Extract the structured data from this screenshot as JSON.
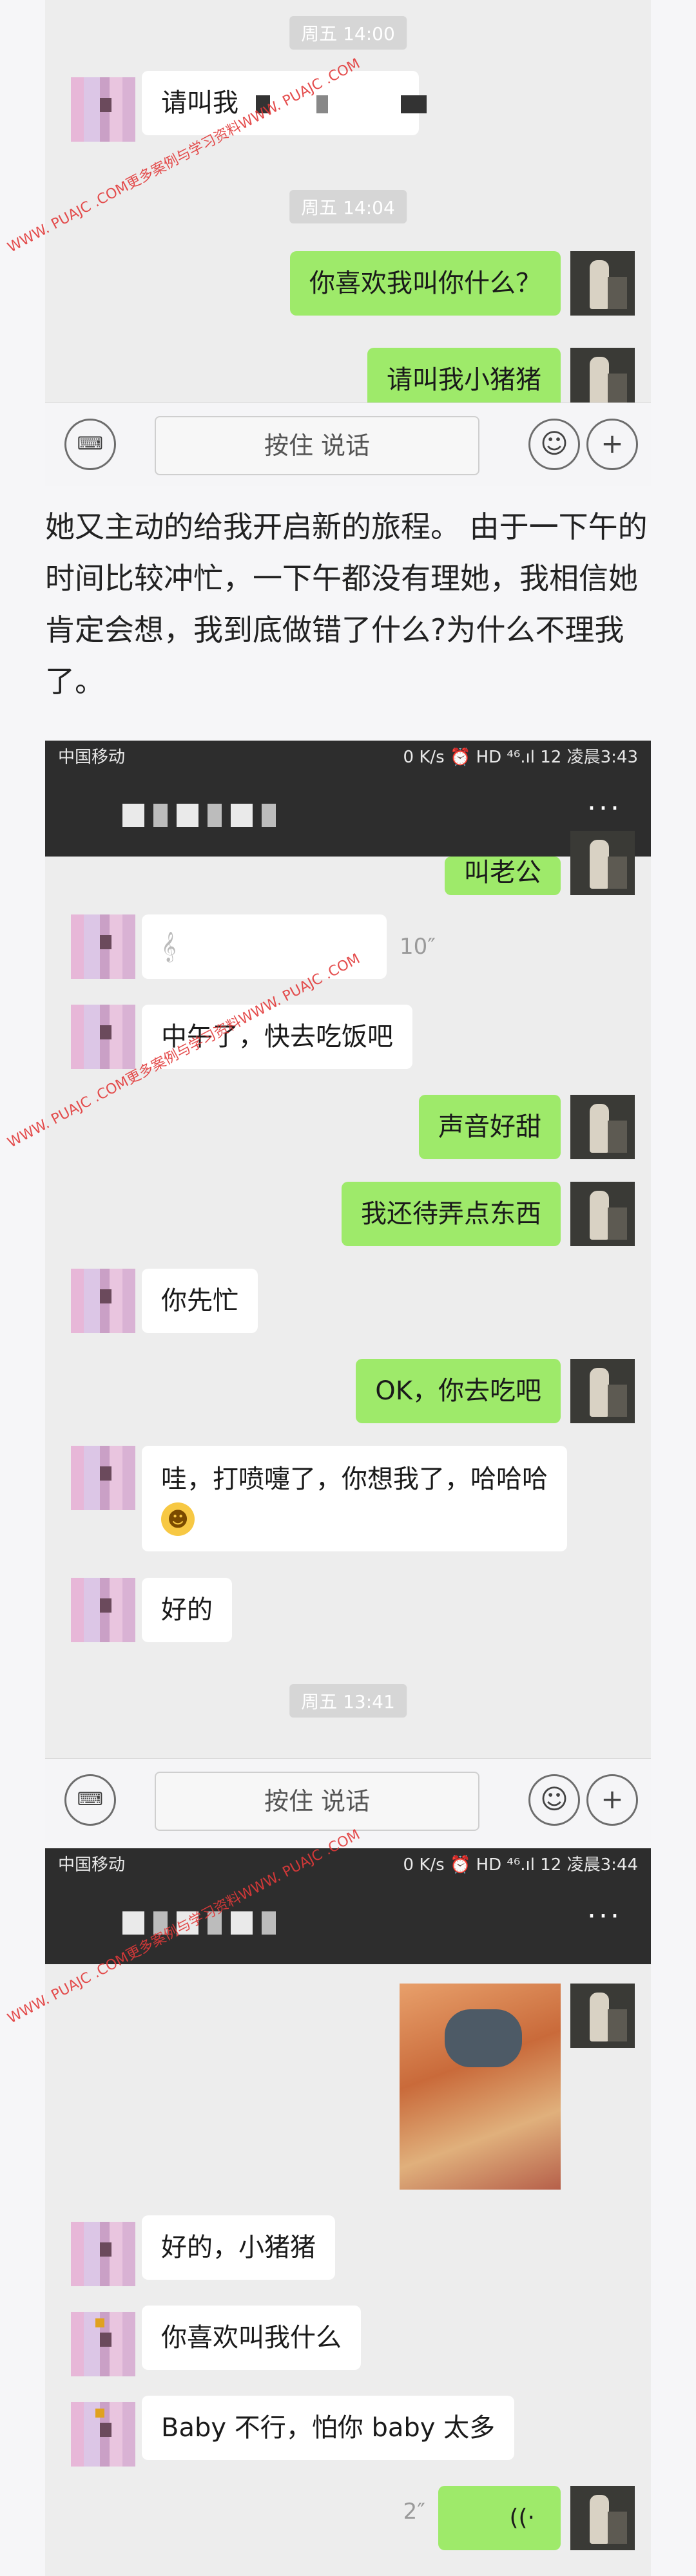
{
  "panel1": {
    "timestamps": [
      "周五 14:00",
      "周五 14:04"
    ],
    "messages": [
      {
        "from": "her",
        "text": "请叫我"
      },
      {
        "from": "me",
        "text": "你喜欢我叫你什么？"
      },
      {
        "from": "me",
        "text": "请叫我小猪猪"
      }
    ],
    "input": {
      "hold_to_talk": "按住 说话"
    }
  },
  "article": {
    "paragraph": "她又主动的给我开启新的旅程。 由于一下午的时间比较冲忙，一下午都没有理她，我相信她肯定会想，我到底做错了什么?为什么不理我了。"
  },
  "panel2": {
    "status": {
      "carrier": "中国移动",
      "right": "0 K/s ⏰ HD ⁴⁶.ıl 12 凌晨3:43"
    },
    "partial_top": "叫老公",
    "voice_duration": "10″",
    "messages": [
      {
        "from": "her",
        "text": "中午了，快去吃饭吧"
      },
      {
        "from": "me",
        "text": "声音好甜"
      },
      {
        "from": "me",
        "text": "我还待弄点东西"
      },
      {
        "from": "her",
        "text": "你先忙"
      },
      {
        "from": "me",
        "text": "OK，你去吃吧"
      },
      {
        "from": "her",
        "text": "哇，打喷嚏了，你想我了，哈哈哈"
      },
      {
        "from": "her",
        "text": "好的"
      }
    ],
    "timestamp": "周五 13:41",
    "input": {
      "hold_to_talk": "按住 说话"
    }
  },
  "panel3": {
    "status": {
      "carrier": "中国移动",
      "right": "0 K/s ⏰ HD ⁴⁶.ıl 12 凌晨3:44"
    },
    "messages": [
      {
        "from": "her",
        "text": "好的，小猪猪"
      },
      {
        "from": "her",
        "text": "你喜欢叫我什么"
      },
      {
        "from": "her",
        "text": "Baby 不行，怕你 baby 太多"
      }
    ],
    "voice_duration": "2″",
    "voice_icon": "((·"
  },
  "watermark": "WWW. PUAJC .COM更多案例与学习资料WWW. PUAJC .COM",
  "icons": {
    "more": "···",
    "plus": "+",
    "emoji": "☺",
    "keyboard": "⌨"
  },
  "colors": {
    "my_bubble": "#9eea6a",
    "her_bubble": "#ffffff",
    "chat_bg": "#ededed",
    "header": "#2d2d2d",
    "watermark": "#e23a3a"
  }
}
